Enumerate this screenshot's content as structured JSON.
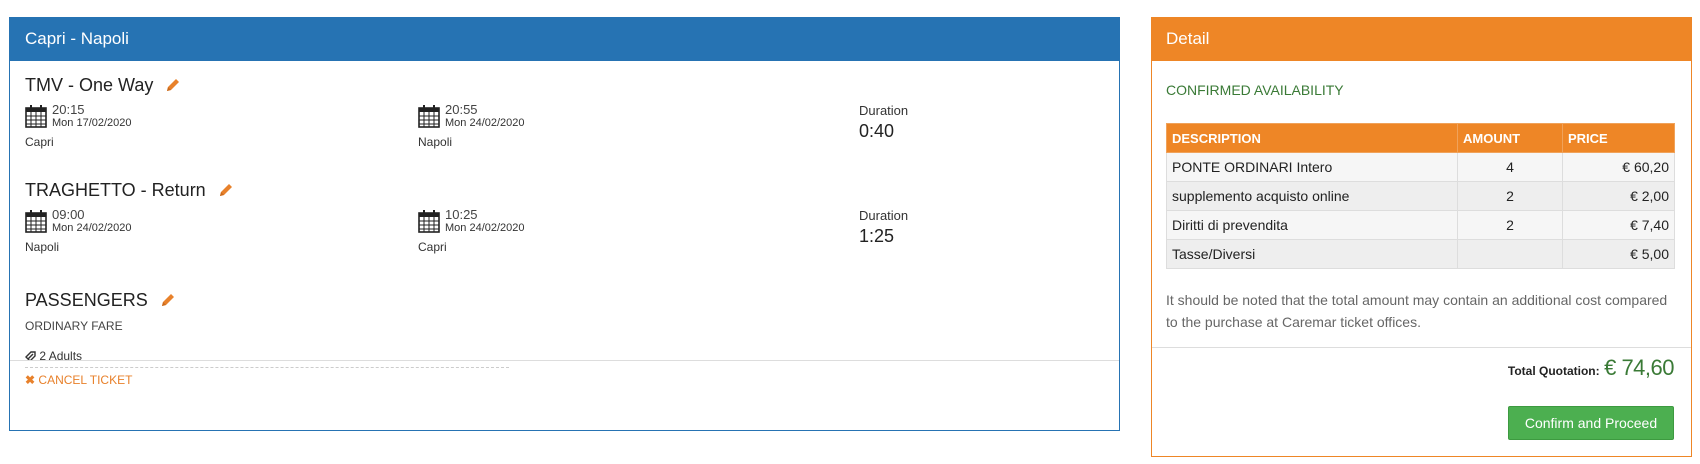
{
  "left": {
    "title": "Capri - Napoli",
    "routes": [
      {
        "title": "TMV - One Way",
        "departure": {
          "time": "20:15",
          "date": "Mon  17/02/2020",
          "port": "Capri"
        },
        "arrival": {
          "time": "20:55",
          "date": "Mon  24/02/2020",
          "port": "Napoli"
        },
        "duration_label": "Duration",
        "duration": "0:40"
      },
      {
        "title": "TRAGHETTO - Return",
        "departure": {
          "time": "09:00",
          "date": "Mon  24/02/2020",
          "port": "Napoli"
        },
        "arrival": {
          "time": "10:25",
          "date": "Mon  24/02/2020",
          "port": "Capri"
        },
        "duration_label": "Duration",
        "duration": "1:25"
      }
    ],
    "passengers": {
      "title": "PASSENGERS",
      "fare": "ORDINARY FARE",
      "adults": "2 Adults"
    },
    "cancel_label": "CANCEL TICKET"
  },
  "right": {
    "title": "Detail",
    "availability": "CONFIRMED AVAILABILITY",
    "table": {
      "headers": [
        "DESCRIPTION",
        "AMOUNT",
        "PRICE"
      ],
      "rows": [
        {
          "description": "PONTE ORDINARI Intero",
          "amount": "4",
          "price": "€ 60,20"
        },
        {
          "description": "supplemento acquisto online",
          "amount": "2",
          "price": "€ 2,00"
        },
        {
          "description": "Diritti di prevendita",
          "amount": "2",
          "price": "€ 7,40"
        },
        {
          "description": "Tasse/Diversi",
          "amount": "",
          "price": "€ 5,00"
        }
      ]
    },
    "note": "It should be noted that the total amount may contain an additional cost compared to the purchase at Caremar ticket offices.",
    "total_label": "Total Quotation:",
    "total_value": "€ 74,60",
    "confirm_label": "Confirm and Proceed"
  },
  "colors": {
    "primary_blue": "#2673b3",
    "accent_orange": "#ee8626",
    "success_green": "#4caf50",
    "availability_green": "#3a7a36"
  }
}
